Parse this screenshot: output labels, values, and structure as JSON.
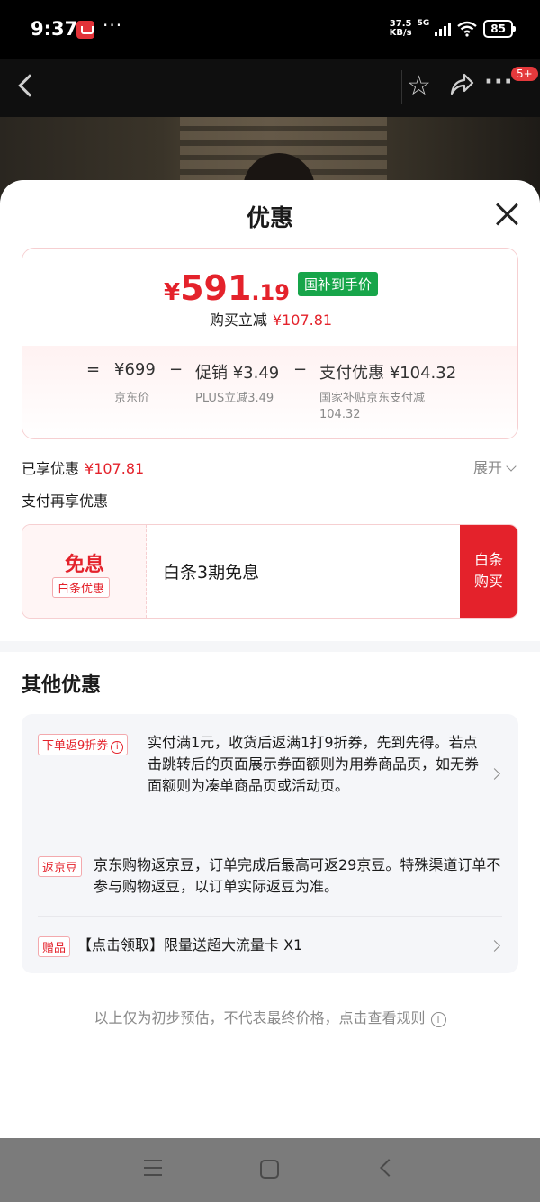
{
  "status_bar": {
    "time": "9:37",
    "dots": "···",
    "speed_top": "37.5",
    "speed_bottom": "KB/s",
    "network": "5G",
    "battery": "85"
  },
  "nav": {
    "badge": "5+",
    "more": "···"
  },
  "sheet": {
    "title": "优惠",
    "price": {
      "yen": "¥",
      "integer": "591",
      "decimal": ".19",
      "tag": "国补到手价",
      "reduce_label": "购买立减",
      "reduce_amount": "¥107.81"
    },
    "calc": {
      "equals": "=",
      "minus": "−",
      "jd_price": "¥699",
      "jd_price_label": "京东价",
      "promo": "促销 ¥3.49",
      "promo_label": "PLUS立减3.49",
      "pay_discount": "支付优惠 ¥104.32",
      "pay_discount_label": "国家补贴京东支付减104.32"
    },
    "enjoyed_label": "已享优惠",
    "enjoyed_amount": "¥107.81",
    "expand_label": "展开",
    "pay_more_label": "支付再享优惠",
    "baitiao": {
      "free_label": "免息",
      "tag": "白条优惠",
      "title": "白条3期免息",
      "button_line1": "白条",
      "button_line2": "购买"
    },
    "other_title": "其他优惠",
    "offers": [
      {
        "tag": "下单返9折券",
        "text": "实付满1元，收货后返满1打9折券，先到先得。若点击跳转后的页面展示券面额则为用券商品页，如无券面额则为凑单商品页或活动页。"
      },
      {
        "tag": "返京豆",
        "text": "京东购物返京豆，订单完成后最高可返29京豆。特殊渠道订单不参与购物返豆，以订单实际返豆为准。"
      },
      {
        "tag": "赠品",
        "text": "【点击领取】限量送超大流量卡 X1"
      }
    ],
    "footnote": "以上仅为初步预估，不代表最终价格，点击查看规则"
  },
  "colors": {
    "accent_red": "#e4222b",
    "tag_green": "#17a54a"
  }
}
